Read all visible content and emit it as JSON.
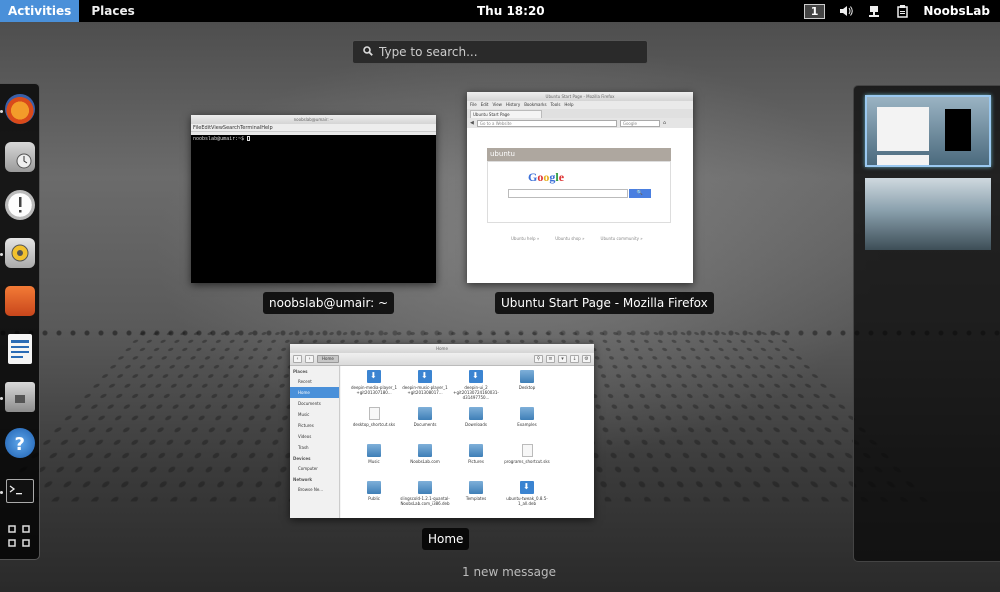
{
  "topbar": {
    "activities": "Activities",
    "places": "Places",
    "clock": "Thu 18:20",
    "workspace_number": "1",
    "user": "NoobsLab",
    "tray_icons": [
      "volume-icon",
      "network-icon",
      "clipboard-icon"
    ]
  },
  "search": {
    "placeholder": "Type to search..."
  },
  "dash": {
    "items": [
      "firefox-icon",
      "mail-icon",
      "chat-icon",
      "audio-player-icon",
      "photo-icon",
      "writer-icon",
      "files-icon",
      "help-icon",
      "terminal-icon",
      "show-apps-icon"
    ]
  },
  "windows": {
    "terminal": {
      "caption": "noobslab@umair: ~",
      "title": "noobslab@umair: ~",
      "menu": "FileEditViewSearchTerminalHelp",
      "prompt": "noobslab@umair:~$"
    },
    "firefox": {
      "caption": "Ubuntu Start Page - Mozilla Firefox",
      "title": "Ubuntu Start Page - Mozilla Firefox",
      "menu": [
        "File",
        "Edit",
        "View",
        "History",
        "Bookmarks",
        "Tools",
        "Help"
      ],
      "tab": "Ubuntu Start Page",
      "url_placeholder": "Go to a Website",
      "search_placeholder": "Google",
      "page_header": "ubuntu",
      "google": "Google",
      "links": [
        "Ubuntu help »",
        "Ubuntu shop »",
        "Ubuntu community »"
      ]
    },
    "files": {
      "caption": "Home",
      "title": "Home",
      "crumb": "Home",
      "sidebar": {
        "places_heading": "Places",
        "places": [
          "Recent",
          "Home",
          "Documents",
          "Music",
          "Pictures",
          "Videos",
          "Trash"
        ],
        "devices_heading": "Devices",
        "devices": [
          "Computer"
        ],
        "network_heading": "Network",
        "network": [
          "Browse Ne..."
        ]
      },
      "items": [
        {
          "label": "deepin-media-player_1 +git201307180...",
          "kind": "dl"
        },
        {
          "label": "deepin-music-player_1 +git201308017...",
          "kind": "dl"
        },
        {
          "label": "deepin-ui_2 +git20130724160031-d31497750...",
          "kind": "dl"
        },
        {
          "label": "Desktop",
          "kind": "folder"
        },
        {
          "label": "desktop_shortcut.sks",
          "kind": "doc"
        },
        {
          "label": "Documents",
          "kind": "folder"
        },
        {
          "label": "Downloads",
          "kind": "folder"
        },
        {
          "label": "Examples",
          "kind": "folder"
        },
        {
          "label": "Music",
          "kind": "folder"
        },
        {
          "label": "NoobsLab.com",
          "kind": "folder"
        },
        {
          "label": "Pictures",
          "kind": "folder"
        },
        {
          "label": "programs_shortcut.sks",
          "kind": "doc"
        },
        {
          "label": "Public",
          "kind": "folder"
        },
        {
          "label": "slingscold-1.2.1-quantal-NoobsLab.com_i386.deb",
          "kind": "folder"
        },
        {
          "label": "Templates",
          "kind": "folder"
        },
        {
          "label": "ubuntu-tweak_0.8.5-1_all.deb",
          "kind": "dl"
        }
      ]
    }
  },
  "notification": "1 new message"
}
